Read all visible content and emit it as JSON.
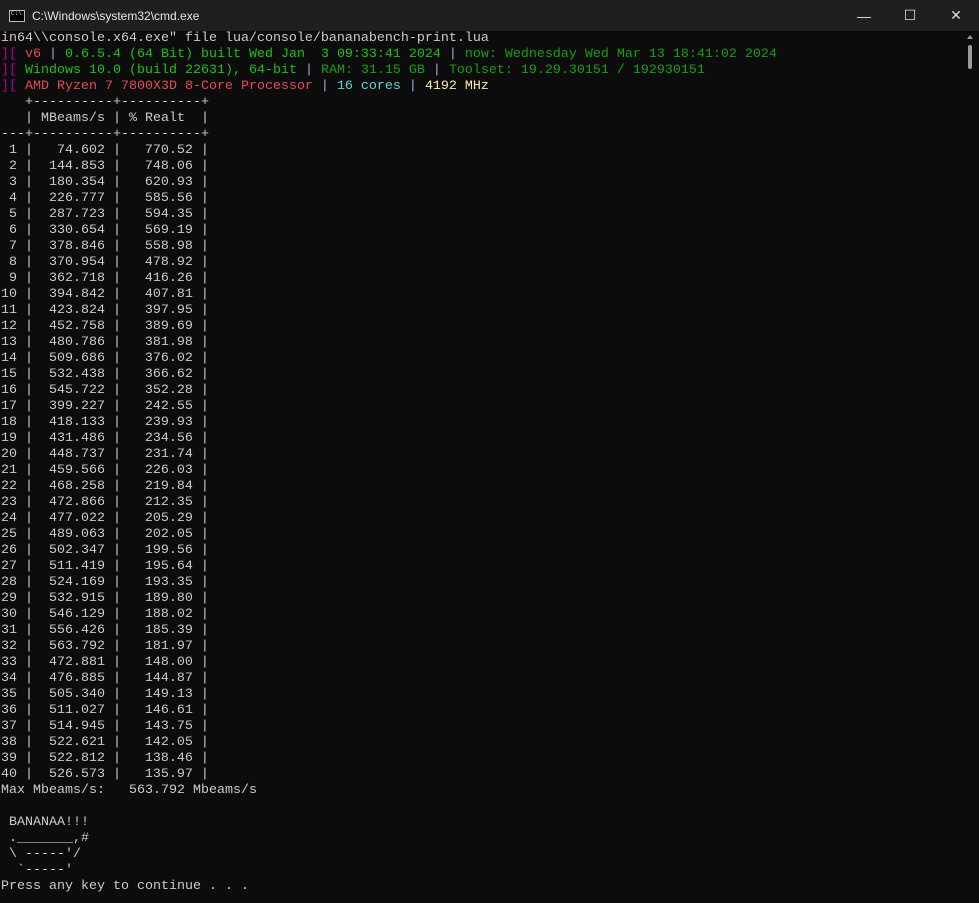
{
  "window": {
    "title": "C:\\Windows\\system32\\cmd.exe",
    "minimize": "—",
    "maximize": "☐",
    "close": "✕"
  },
  "colors": {
    "magenta": "#b4009e",
    "red": "#e74856",
    "green": "#16c60c",
    "sep": "#8fb4d6",
    "cyan": "#61d6d6",
    "yellow": "#f9f1a5",
    "dimgreen": "#13a10e",
    "darkred": "#c50f1f",
    "text": "#cccccc"
  },
  "header_lines": [
    [
      {
        "t": "in64\\\\console.x64.exe\" file lua/console/bananabench-print.lua",
        "c": "text"
      }
    ],
    [
      {
        "t": "][ ",
        "c": "magenta"
      },
      {
        "t": "v6",
        "c": "red"
      },
      {
        "t": " | ",
        "c": "sep"
      },
      {
        "t": "0.6.5.4 (64 Bit) built Wed Jan  3 09:33:41 2024",
        "c": "green"
      },
      {
        "t": " | ",
        "c": "sep"
      },
      {
        "t": "now: Wednesday Wed Mar 13 18:41:02 2024",
        "c": "dimgreen"
      }
    ],
    [
      {
        "t": "][ ",
        "c": "magenta"
      },
      {
        "t": "Windows 10.0 (build 22631), 64-bit",
        "c": "green"
      },
      {
        "t": " | ",
        "c": "sep"
      },
      {
        "t": "RAM: 31.15 GB",
        "c": "dimgreen"
      },
      {
        "t": " | ",
        "c": "sep"
      },
      {
        "t": "Toolset: 19.29.30151 / 192930151",
        "c": "dimgreen"
      }
    ],
    [
      {
        "t": "][ ",
        "c": "magenta"
      },
      {
        "t": "AMD Ryzen 7 7800X3D 8-Core Processor",
        "c": "red"
      },
      {
        "t": " | ",
        "c": "sep"
      },
      {
        "t": "16 cores",
        "c": "cyan"
      },
      {
        "t": " | ",
        "c": "sep"
      },
      {
        "t": "4192 MHz",
        "c": "yellow"
      }
    ]
  ],
  "table": {
    "top_border": "   +----------+----------+",
    "header": "   | MBeams/s | % Realt  |",
    "mid_border": "---+----------+----------+",
    "rows": [
      [
        "1",
        "74.602",
        "770.52"
      ],
      [
        "2",
        "144.853",
        "748.06"
      ],
      [
        "3",
        "180.354",
        "620.93"
      ],
      [
        "4",
        "226.777",
        "585.56"
      ],
      [
        "5",
        "287.723",
        "594.35"
      ],
      [
        "6",
        "330.654",
        "569.19"
      ],
      [
        "7",
        "378.846",
        "558.98"
      ],
      [
        "8",
        "370.954",
        "478.92"
      ],
      [
        "9",
        "362.718",
        "416.26"
      ],
      [
        "10",
        "394.842",
        "407.81"
      ],
      [
        "11",
        "423.824",
        "397.95"
      ],
      [
        "12",
        "452.758",
        "389.69"
      ],
      [
        "13",
        "480.786",
        "381.98"
      ],
      [
        "14",
        "509.686",
        "376.02"
      ],
      [
        "15",
        "532.438",
        "366.62"
      ],
      [
        "16",
        "545.722",
        "352.28"
      ],
      [
        "17",
        "399.227",
        "242.55"
      ],
      [
        "18",
        "418.133",
        "239.93"
      ],
      [
        "19",
        "431.486",
        "234.56"
      ],
      [
        "20",
        "448.737",
        "231.74"
      ],
      [
        "21",
        "459.566",
        "226.03"
      ],
      [
        "22",
        "468.258",
        "219.84"
      ],
      [
        "23",
        "472.866",
        "212.35"
      ],
      [
        "24",
        "477.022",
        "205.29"
      ],
      [
        "25",
        "489.063",
        "202.05"
      ],
      [
        "26",
        "502.347",
        "199.56"
      ],
      [
        "27",
        "511.419",
        "195.64"
      ],
      [
        "28",
        "524.169",
        "193.35"
      ],
      [
        "29",
        "532.915",
        "189.80"
      ],
      [
        "30",
        "546.129",
        "188.02"
      ],
      [
        "31",
        "556.426",
        "185.39"
      ],
      [
        "32",
        "563.792",
        "181.97"
      ],
      [
        "33",
        "472.881",
        "148.00"
      ],
      [
        "34",
        "476.885",
        "144.87"
      ],
      [
        "35",
        "505.340",
        "149.13"
      ],
      [
        "36",
        "511.027",
        "146.61"
      ],
      [
        "37",
        "514.945",
        "143.75"
      ],
      [
        "38",
        "522.621",
        "142.05"
      ],
      [
        "39",
        "522.812",
        "138.46"
      ],
      [
        "40",
        "526.573",
        "135.97"
      ]
    ]
  },
  "footer_lines": [
    "Max Mbeams/s:   563.792 Mbeams/s",
    "",
    " BANANAA!!!",
    " ._______,#",
    " \\ -----'/",
    "  `-----'",
    "Press any key to continue . . ."
  ]
}
